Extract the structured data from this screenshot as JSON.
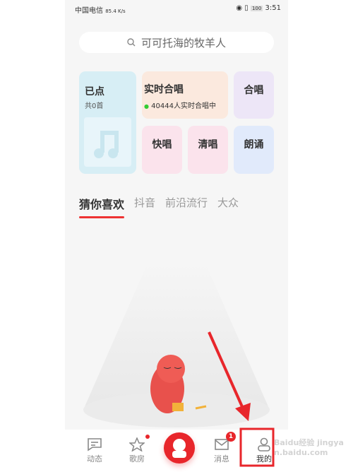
{
  "status_bar": {
    "carrier": "中国电信",
    "net_speed": "85.4 K/s",
    "battery": "100",
    "time": "3:51"
  },
  "search": {
    "placeholder": "可可托海的牧羊人"
  },
  "cards": {
    "ordered": {
      "title": "已点",
      "subtitle": "共0首"
    },
    "live_chorus": {
      "title": "实时合唱",
      "subtitle": "40444人实时合唱中"
    },
    "chorus": {
      "title": "合唱"
    },
    "fast_sing": {
      "title": "快唱"
    },
    "a_cappella": {
      "title": "清唱"
    },
    "recite": {
      "title": "朗诵"
    }
  },
  "tabs": [
    {
      "label": "猜你喜欢",
      "active": true
    },
    {
      "label": "抖音"
    },
    {
      "label": "前沿流行"
    },
    {
      "label": "大众"
    }
  ],
  "nav": {
    "items": [
      {
        "label": "动态"
      },
      {
        "label": "歌房",
        "dot": true
      },
      {
        "label": ""
      },
      {
        "label": "消息",
        "badge": "1"
      },
      {
        "label": "我的"
      }
    ]
  },
  "colors": {
    "accent": "#e8262b",
    "annotation": "#e8262b"
  },
  "watermark": "Baidu经验 jingyan.baidu.com"
}
